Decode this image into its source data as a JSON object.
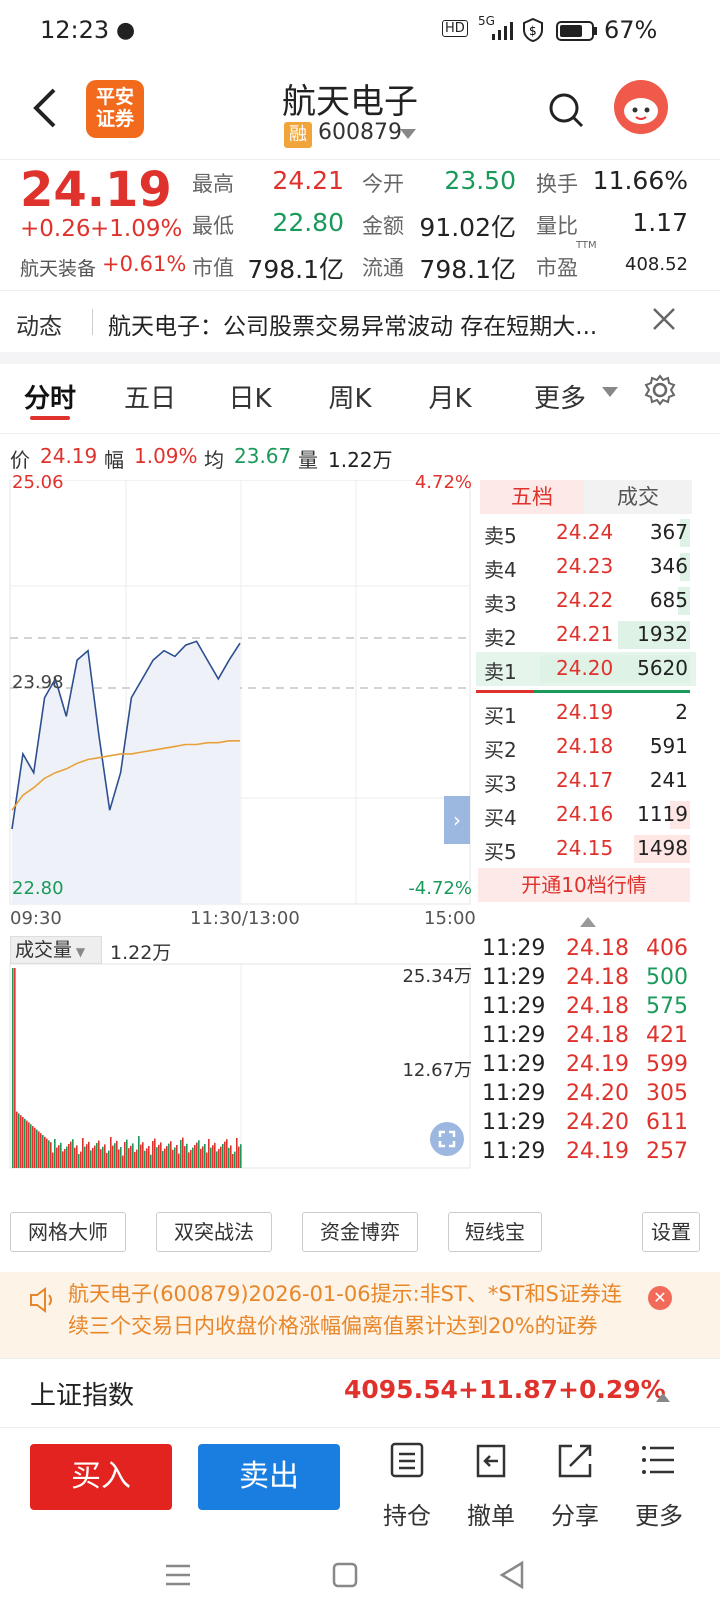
{
  "status": {
    "time": "12:23",
    "hd": "HD",
    "net": "5G",
    "battery": "67%"
  },
  "nav": {
    "broker_logo": "平安\n证券",
    "stock_name": "航天电子",
    "rong_badge": "融",
    "stock_code": "600879"
  },
  "quote": {
    "price": "24.19",
    "change": "+0.26",
    "change_pct": "+1.09%",
    "sector_label": "航天装备",
    "sector_pct": "+0.61%",
    "fields": [
      {
        "label": "最高",
        "value": "24.21"
      },
      {
        "label": "今开",
        "value": "23.50"
      },
      {
        "label": "换手",
        "value": "11.66%"
      },
      {
        "label": "最低",
        "value": "22.80"
      },
      {
        "label": "金额",
        "value": "91.02亿"
      },
      {
        "label": "量比",
        "value": "1.17"
      },
      {
        "label": "市值",
        "value": "798.1亿"
      },
      {
        "label": "流通",
        "value": "798.1亿"
      },
      {
        "label": "市盈",
        "value": "408.52",
        "sup": "TTM"
      }
    ]
  },
  "news": {
    "label": "动态",
    "text": "航天电子：公司股票交易异常波动 存在短期大..."
  },
  "tabs": [
    "分时",
    "五日",
    "日K",
    "周K",
    "月K",
    "更多"
  ],
  "infoline": {
    "price_label": "价",
    "price": "24.19",
    "range_label": "幅",
    "range": "1.09%",
    "avg_label": "均",
    "avg": "23.67",
    "vol_label": "量",
    "vol": "1.22万"
  },
  "chart": {
    "y_top": "25.06",
    "y_mid": "23.98",
    "y_bot": "22.80",
    "pct_top": "4.72%",
    "pct_bot": "-4.72%",
    "x_start": "09:30",
    "x_mid": "11:30/13:00",
    "x_end": "15:00",
    "vol_label": "成交量",
    "vol_value": "1.22万",
    "vol_top": "25.34万",
    "vol_mid": "12.67万"
  },
  "chart_data": {
    "type": "line",
    "title": "",
    "series": [
      {
        "values": [
          23.2,
          23.6,
          23.5,
          23.9,
          24.0,
          23.8,
          24.1,
          24.15,
          23.7,
          23.3,
          23.5,
          23.9,
          24.0,
          24.1,
          24.15,
          24.12,
          24.18,
          24.2,
          24.1,
          24.0,
          24.1,
          24.19
        ]
      },
      {
        "values": [
          23.3,
          23.38,
          23.42,
          23.47,
          23.5,
          23.52,
          23.55,
          23.57,
          23.58,
          23.59,
          23.6,
          23.6,
          23.61,
          23.62,
          23.63,
          23.64,
          23.65,
          23.65,
          23.66,
          23.66,
          23.67,
          23.67
        ]
      }
    ],
    "ylim": [
      22.8,
      25.06
    ],
    "prev_close": 23.93
  },
  "orderbook": {
    "tab_five": "五档",
    "tab_trade": "成交",
    "asks": [
      {
        "label": "卖5",
        "price": "24.24",
        "vol": "367"
      },
      {
        "label": "卖4",
        "price": "24.23",
        "vol": "346"
      },
      {
        "label": "卖3",
        "price": "24.22",
        "vol": "685"
      },
      {
        "label": "卖2",
        "price": "24.21",
        "vol": "1932"
      },
      {
        "label": "卖1",
        "price": "24.20",
        "vol": "5620"
      }
    ],
    "bids": [
      {
        "label": "买1",
        "price": "24.19",
        "vol": "2"
      },
      {
        "label": "买2",
        "price": "24.18",
        "vol": "591"
      },
      {
        "label": "买3",
        "price": "24.17",
        "vol": "241"
      },
      {
        "label": "买4",
        "price": "24.16",
        "vol": "1119"
      },
      {
        "label": "买5",
        "price": "24.15",
        "vol": "1498"
      }
    ],
    "open_ten": "开通10档行情"
  },
  "ticks": [
    {
      "time": "11:29",
      "price": "24.18",
      "vol": "406",
      "c": "red"
    },
    {
      "time": "11:29",
      "price": "24.18",
      "vol": "500",
      "c": "green"
    },
    {
      "time": "11:29",
      "price": "24.18",
      "vol": "575",
      "c": "green"
    },
    {
      "time": "11:29",
      "price": "24.18",
      "vol": "421",
      "c": "red"
    },
    {
      "time": "11:29",
      "price": "24.19",
      "vol": "599",
      "c": "red"
    },
    {
      "time": "11:29",
      "price": "24.20",
      "vol": "305",
      "c": "red"
    },
    {
      "time": "11:29",
      "price": "24.20",
      "vol": "611",
      "c": "red"
    },
    {
      "time": "11:29",
      "price": "24.19",
      "vol": "257",
      "c": "red"
    }
  ],
  "tools": [
    "网格大师",
    "双突战法",
    "资金博弈",
    "短线宝",
    "设置"
  ],
  "notice": {
    "text": "航天电子(600879)2026-01-06提示:非ST、*ST和S证券连续三个交易日内收盘价格涨幅偏离值累计达到20%的证券"
  },
  "index": {
    "name": "上证指数",
    "value": "4095.54",
    "change": "+11.87",
    "pct": "+0.29%"
  },
  "bottom": {
    "buy": "买入",
    "sell": "卖出",
    "hold": "持仓",
    "cancel": "撤单",
    "share": "分享",
    "more": "更多"
  },
  "colors": {
    "red": "#e0322c",
    "green": "#1a9a5a",
    "blue": "#1a7de0"
  }
}
